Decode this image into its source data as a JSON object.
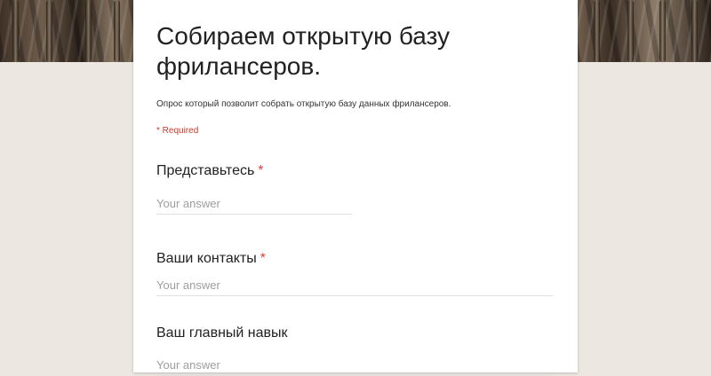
{
  "form": {
    "title": "Собираем открытую базу фрилансеров.",
    "description": "Опрос который позволит собрать открытую базу данных фрилансеров.",
    "required_note": "* Required",
    "questions": [
      {
        "label": "Представьтесь",
        "required_mark": "*",
        "placeholder": "Your answer"
      },
      {
        "label": "Ваши контакты",
        "required_mark": "*",
        "placeholder": "Your answer"
      },
      {
        "label": "Ваш главный навык",
        "required_mark": "",
        "placeholder": "Your answer"
      }
    ]
  },
  "colors": {
    "background": "#ece7e1",
    "card": "#ffffff",
    "required": "#db4437",
    "placeholder": "#9e9e9e"
  }
}
